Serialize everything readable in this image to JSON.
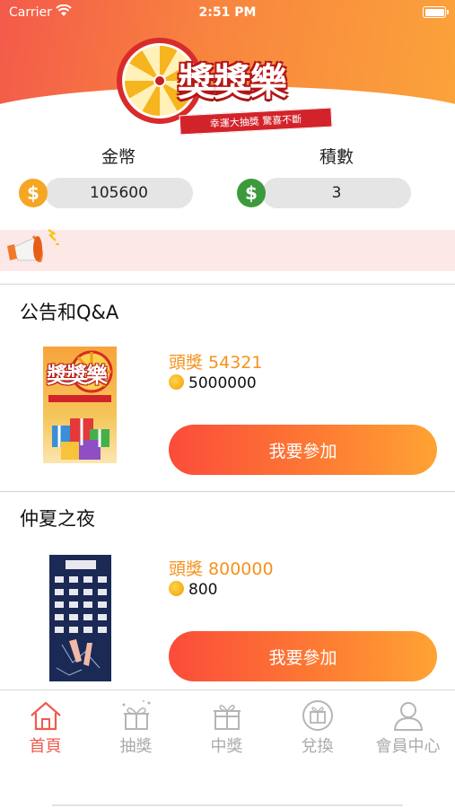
{
  "status_bar": {
    "carrier": "Carrier",
    "time": "2:51 PM"
  },
  "logo": {
    "title": "獎獎樂",
    "ribbon": "幸運大抽獎 驚喜不斷"
  },
  "currency": {
    "coins_label": "金幣",
    "coins_value": "105600",
    "coins_icon": "$",
    "coins_color": "#f5a623",
    "points_label": "積數",
    "points_value": "3",
    "points_icon": "$",
    "points_color": "#3c9a3c"
  },
  "sections": [
    {
      "title": "公告和Q&A",
      "prize": "頭獎 54321",
      "coins": "5000000",
      "join_label": "我要參加",
      "thumb_title": "獎獎樂"
    },
    {
      "title": "仲夏之夜",
      "prize": "頭獎 800000",
      "coins": "800",
      "join_label": "我要參加"
    }
  ],
  "tabs": [
    {
      "label": "首頁",
      "icon": "home-icon",
      "active": true
    },
    {
      "label": "抽獎",
      "icon": "gift-draw-icon",
      "active": false
    },
    {
      "label": "中獎",
      "icon": "gift-box-icon",
      "active": false
    },
    {
      "label": "兌換",
      "icon": "exchange-icon",
      "active": false
    },
    {
      "label": "會員中心",
      "icon": "member-icon",
      "active": false
    }
  ],
  "colors": {
    "accent": "#ef5b4c",
    "prize_text": "#f5921d",
    "notice_bg": "#fde8e8"
  }
}
